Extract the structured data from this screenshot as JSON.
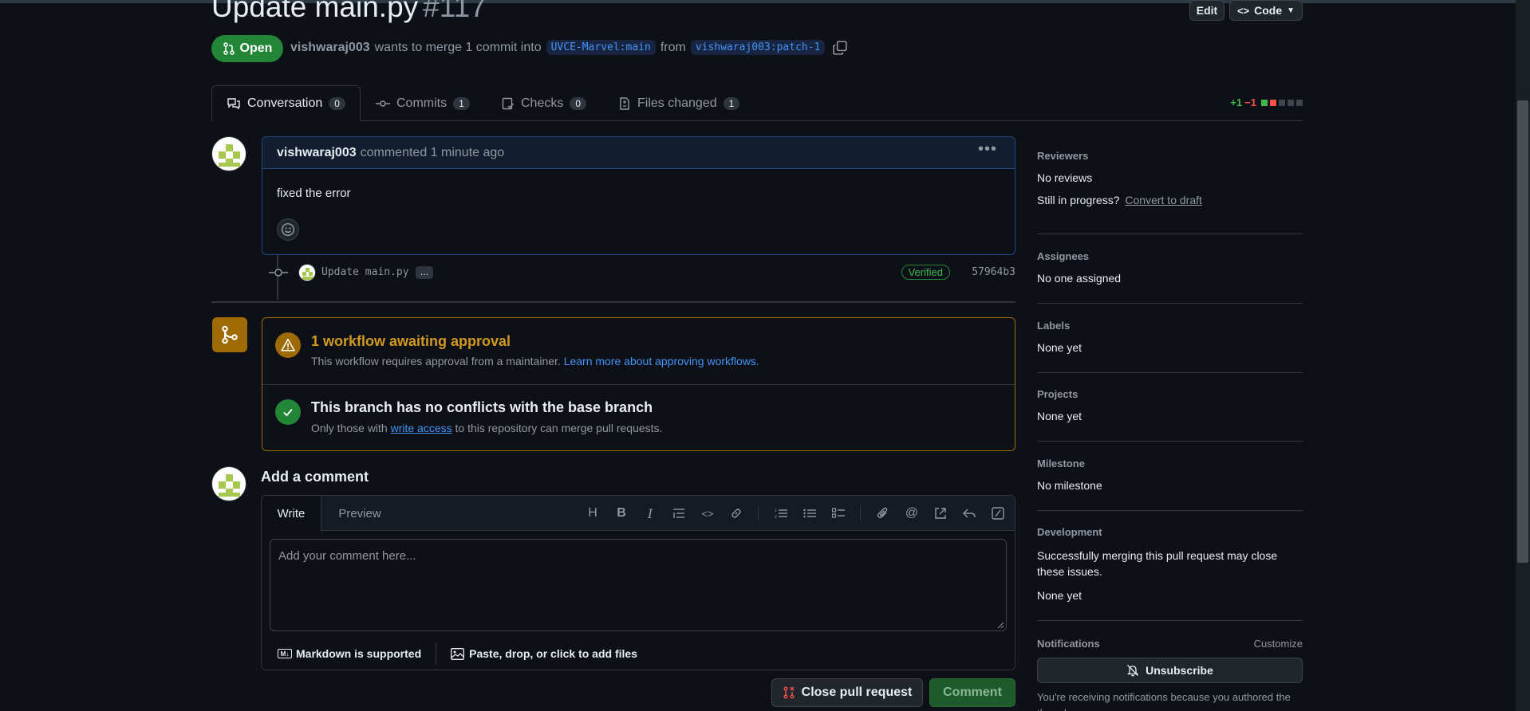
{
  "header": {
    "title": "Update main.py",
    "number": "#117",
    "edit_label": "Edit",
    "code_label": "Code"
  },
  "state": {
    "label": "Open",
    "author": "vishwaraj003",
    "action": "wants to merge 1 commit into",
    "base": "UVCE-Marvel:main",
    "from_text": "from",
    "head": "vishwaraj003:patch-1"
  },
  "tabs": [
    {
      "label": "Conversation",
      "count": "0"
    },
    {
      "label": "Commits",
      "count": "1"
    },
    {
      "label": "Checks",
      "count": "0"
    },
    {
      "label": "Files changed",
      "count": "1"
    }
  ],
  "diffstat": {
    "added": "+1",
    "removed": "−1",
    "colors": {
      "added": "#3fb950",
      "removed": "#f85149"
    }
  },
  "comment": {
    "author": "vishwaraj003",
    "meta": "commented 1 minute ago",
    "body": "fixed the error"
  },
  "commit": {
    "message": "Update main.py",
    "more": "…",
    "verified": "Verified",
    "sha": "57964b3"
  },
  "merge": {
    "workflow_title": "1 workflow awaiting approval",
    "workflow_desc": "This workflow requires approval from a maintainer.",
    "workflow_link": "Learn more about approving workflows.",
    "branch_title": "This branch has no conflicts with the base branch",
    "branch_desc_pre": "Only those with",
    "branch_link": "write access",
    "branch_desc_post": "to this repository can merge pull requests."
  },
  "add_comment": {
    "title": "Add a comment",
    "tab_write": "Write",
    "tab_preview": "Preview",
    "placeholder": "Add your comment here...",
    "markdown_note": "Markdown is supported",
    "attach_note": "Paste, drop, or click to add files",
    "close_button": "Close pull request",
    "comment_button": "Comment"
  },
  "sidebar": {
    "reviewers": {
      "heading": "Reviewers",
      "value": "No reviews",
      "progress_q": "Still in progress?",
      "convert": "Convert to draft"
    },
    "assignees": {
      "heading": "Assignees",
      "value": "No one assigned"
    },
    "labels": {
      "heading": "Labels",
      "value": "None yet"
    },
    "projects": {
      "heading": "Projects",
      "value": "None yet"
    },
    "milestone": {
      "heading": "Milestone",
      "value": "No milestone"
    },
    "development": {
      "heading": "Development",
      "desc": "Successfully merging this pull request may close these issues.",
      "value": "None yet"
    },
    "notifications": {
      "heading": "Notifications",
      "customize": "Customize",
      "unsubscribe": "Unsubscribe",
      "reason": "You're receiving notifications because you authored the thread."
    }
  }
}
